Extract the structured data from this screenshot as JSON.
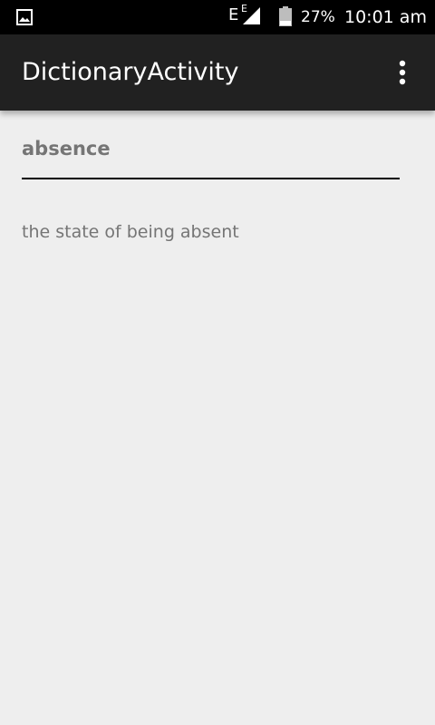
{
  "status_bar": {
    "network_label": "E",
    "network_label_small": "E",
    "battery_percent": "27%",
    "time": "10:01 am",
    "left_icon": "image-icon",
    "signal_icon": "signal-icon",
    "battery_icon": "battery-icon"
  },
  "app_bar": {
    "title": "DictionaryActivity",
    "overflow_icon": "more-vert-icon"
  },
  "content": {
    "word_value": "absence",
    "definition": "the state of being absent"
  },
  "colors": {
    "status_bar_bg": "#000000",
    "app_bar_bg": "#212121",
    "content_bg": "#eeeeee",
    "secondary_text": "#757575",
    "underline": "#000000"
  }
}
